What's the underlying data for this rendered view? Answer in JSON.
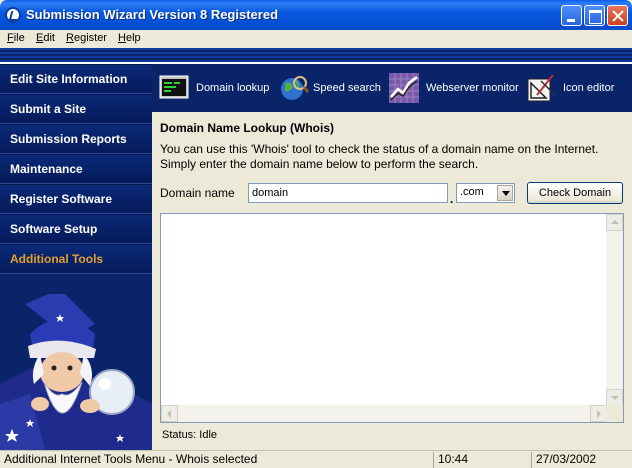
{
  "window": {
    "title": "Submission Wizard Version 8 Registered"
  },
  "menu": [
    {
      "label": "File",
      "accel": "F",
      "rest": "ile"
    },
    {
      "label": "Edit",
      "accel": "E",
      "rest": "dit"
    },
    {
      "label": "Register",
      "accel": "R",
      "rest": "egister"
    },
    {
      "label": "Help",
      "accel": "H",
      "rest": "elp"
    }
  ],
  "sidebar": {
    "items": [
      {
        "label": "Edit Site Information"
      },
      {
        "label": "Submit a Site"
      },
      {
        "label": "Submission Reports"
      },
      {
        "label": "Maintenance"
      },
      {
        "label": "Register Software"
      },
      {
        "label": "Software Setup"
      },
      {
        "label": "Additional Tools",
        "active": true
      }
    ]
  },
  "toolbar": {
    "tools": [
      {
        "label": "Domain lookup",
        "icon": "terminal-icon"
      },
      {
        "label": "Speed search",
        "icon": "globe-magnifier-icon"
      },
      {
        "label": "Webserver monitor",
        "icon": "chart-monitor-icon"
      },
      {
        "label": "Icon editor",
        "icon": "drafting-tools-icon"
      }
    ]
  },
  "lookup": {
    "heading": "Domain Name Lookup (Whois)",
    "description": "You can use this 'Whois' tool to check the status of a domain name on the Internet. Simply enter the domain name below to perform the search.",
    "domain_label": "Domain name",
    "domain_value": "domain",
    "dot": ".",
    "tld_value": ".com",
    "check_button": "Check Domain",
    "status": "Status:  Idle"
  },
  "statusbar": {
    "message": "Additional Internet Tools Menu - Whois selected",
    "time": "10:44",
    "date": "27/03/2002"
  },
  "colors": {
    "nav_bg": "#0a246a",
    "active_nav": "#e0a030",
    "title_bar": "#0958e0"
  }
}
